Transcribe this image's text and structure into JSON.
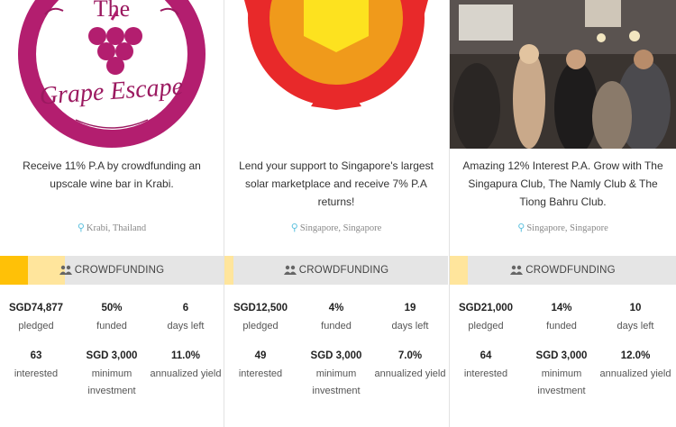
{
  "bar_label": "CROWDFUNDING",
  "colors": {
    "bar_bg": "#e5e5e5",
    "fill_light": "#ffe59c",
    "fill_strong": "#ffc107",
    "pin": "#5bc0de"
  },
  "cards": [
    {
      "logo": {
        "line1": "The",
        "line2": "Grape Escape"
      },
      "title": "Receive 11% P.A by crowdfunding an upscale wine bar in Krabi.",
      "location": "Krabi, Thailand",
      "funded_fraction": 0.5,
      "stats": [
        {
          "value": "SGD74,877",
          "label": "pledged"
        },
        {
          "value": "50%",
          "label": "funded"
        },
        {
          "value": "6",
          "label": "days left"
        },
        {
          "value": "63",
          "label": "interested"
        },
        {
          "value": "SGD 3,000",
          "label": "minimum investment"
        },
        {
          "value": "11.0%",
          "label": "annualized yield"
        }
      ]
    },
    {
      "title": "Lend your support to Singapore's largest solar marketplace and receive 7% P.A returns!",
      "location": "Singapore, Singapore",
      "funded_fraction": 0.04,
      "stats": [
        {
          "value": "SGD12,500",
          "label": "pledged"
        },
        {
          "value": "4%",
          "label": "funded"
        },
        {
          "value": "19",
          "label": "days left"
        },
        {
          "value": "49",
          "label": "interested"
        },
        {
          "value": "SGD 3,000",
          "label": "minimum investment"
        },
        {
          "value": "7.0%",
          "label": "annualized yield"
        }
      ]
    },
    {
      "title": "Amazing 12% Interest P.A. Grow with The Singapura Club, The Namly Club & The Tiong Bahru Club.",
      "location": "Singapore, Singapore",
      "funded_fraction": 0.14,
      "stats": [
        {
          "value": "SGD21,000",
          "label": "pledged"
        },
        {
          "value": "14%",
          "label": "funded"
        },
        {
          "value": "10",
          "label": "days left"
        },
        {
          "value": "64",
          "label": "interested"
        },
        {
          "value": "SGD 3,000",
          "label": "minimum investment"
        },
        {
          "value": "12.0%",
          "label": "annualized yield"
        }
      ]
    }
  ]
}
